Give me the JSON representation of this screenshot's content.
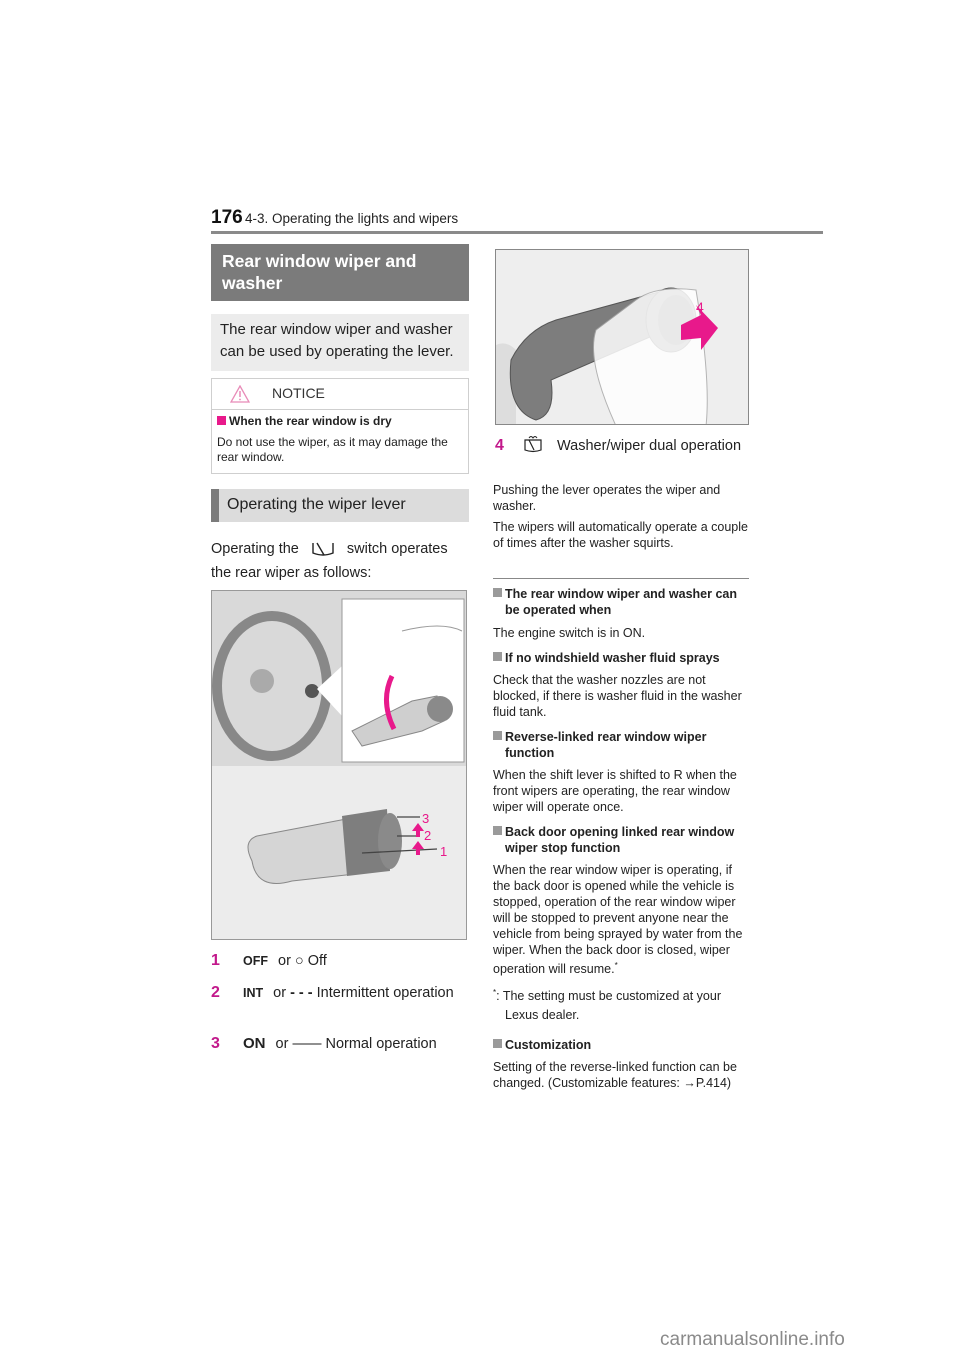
{
  "header": {
    "page_number": "176",
    "chapter": "4-3. Operating the lights and wipers"
  },
  "left": {
    "section_title": "Rear window wiper and washer",
    "intro": "The rear window wiper and washer can be used by operating the lever.",
    "notice": {
      "label": "NOTICE",
      "subhead": "When the rear window is dry",
      "body": "Do not use the wiper, as it may damage the rear window."
    },
    "subsection_title": "Operating the wiper lever",
    "operating_pre": "Operating the",
    "operating_post": "switch operates the rear wiper as follows:",
    "figure_labels": [
      "3",
      "2",
      "1"
    ],
    "items": [
      {
        "num": "1",
        "button": "OFF",
        "or": "or",
        "symbol": "○",
        "text": "Off"
      },
      {
        "num": "2",
        "button": "INT",
        "or": "or",
        "symbol": "- - -",
        "text": "Intermittent operation"
      },
      {
        "num": "3",
        "button": "ON",
        "or": "or",
        "symbol": "——",
        "text": "Normal operation"
      }
    ]
  },
  "right": {
    "figure_label": "4",
    "item4": {
      "num": "4",
      "text": "Washer/wiper dual operation"
    },
    "para1": "Pushing the lever operates the wiper and washer.",
    "para2": "The wipers will automatically operate a couple of times after the washer squirts.",
    "notes": [
      {
        "title": "The rear window wiper and washer can be operated when",
        "body": "The engine switch is in ON."
      },
      {
        "title": "If no windshield washer fluid sprays",
        "body": "Check that the washer nozzles are not blocked, if there is washer fluid in the washer fluid tank."
      },
      {
        "title": "Reverse-linked rear window wiper function",
        "body": "When the shift lever is shifted to R when the front wipers are operating, the rear window wiper will operate once."
      },
      {
        "title": "Back door opening linked rear window wiper stop function",
        "body": "When the rear window wiper is operating, if the back door is opened while the vehicle is stopped, operation of the rear window wiper will be stopped to prevent anyone near the vehicle from being sprayed by water from the wiper. When the back door is closed, wiper operation will resume."
      }
    ],
    "footnote_mark": "*",
    "footnote": ": The setting must be customized at your Lexus dealer.",
    "customization": {
      "title": "Customization",
      "body": "Setting of the reverse-linked function can be changed. (Customizable features: →P.414)"
    }
  },
  "watermark": "carmanualsonline.info",
  "colors": {
    "accent": "#c2188b",
    "heading_bg": "#7b7b7b",
    "subheading_bg": "#dcdcdc"
  }
}
